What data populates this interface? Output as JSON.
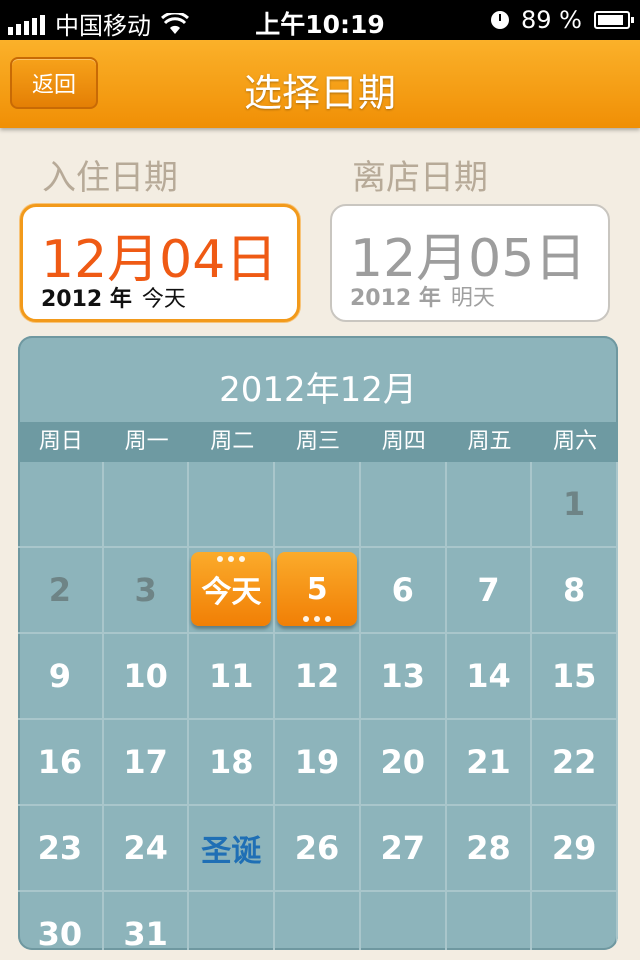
{
  "status_bar": {
    "carrier": "中国移动",
    "time": "上午10:19",
    "battery": "89 %",
    "battery_level": 0.89
  },
  "nav": {
    "back_label": "返回",
    "title": "选择日期"
  },
  "checkin": {
    "label": "入住日期",
    "date": "12月04日",
    "year": "2012 年",
    "relative": "今天"
  },
  "checkout": {
    "label": "离店日期",
    "date": "12月05日",
    "year": "2012 年",
    "relative": "明天"
  },
  "calendar": {
    "title": "2012年12月",
    "weekdays": [
      "周日",
      "周一",
      "周二",
      "周三",
      "周四",
      "周五",
      "周六"
    ],
    "rows": [
      [
        "",
        "",
        "",
        "",
        "",
        "",
        "1"
      ],
      [
        "2",
        "3",
        "今天",
        "5",
        "6",
        "7",
        "8"
      ],
      [
        "9",
        "10",
        "11",
        "12",
        "13",
        "14",
        "15"
      ],
      [
        "16",
        "17",
        "18",
        "19",
        "20",
        "21",
        "22"
      ],
      [
        "23",
        "24",
        "圣诞",
        "26",
        "27",
        "28",
        "29"
      ],
      [
        "30",
        "31",
        "",
        "",
        "",
        "",
        ""
      ]
    ]
  },
  "colors": {
    "accent": "#f08f05",
    "calendar_bg": "#8db4bb",
    "holiday": "#1f6fb5"
  }
}
